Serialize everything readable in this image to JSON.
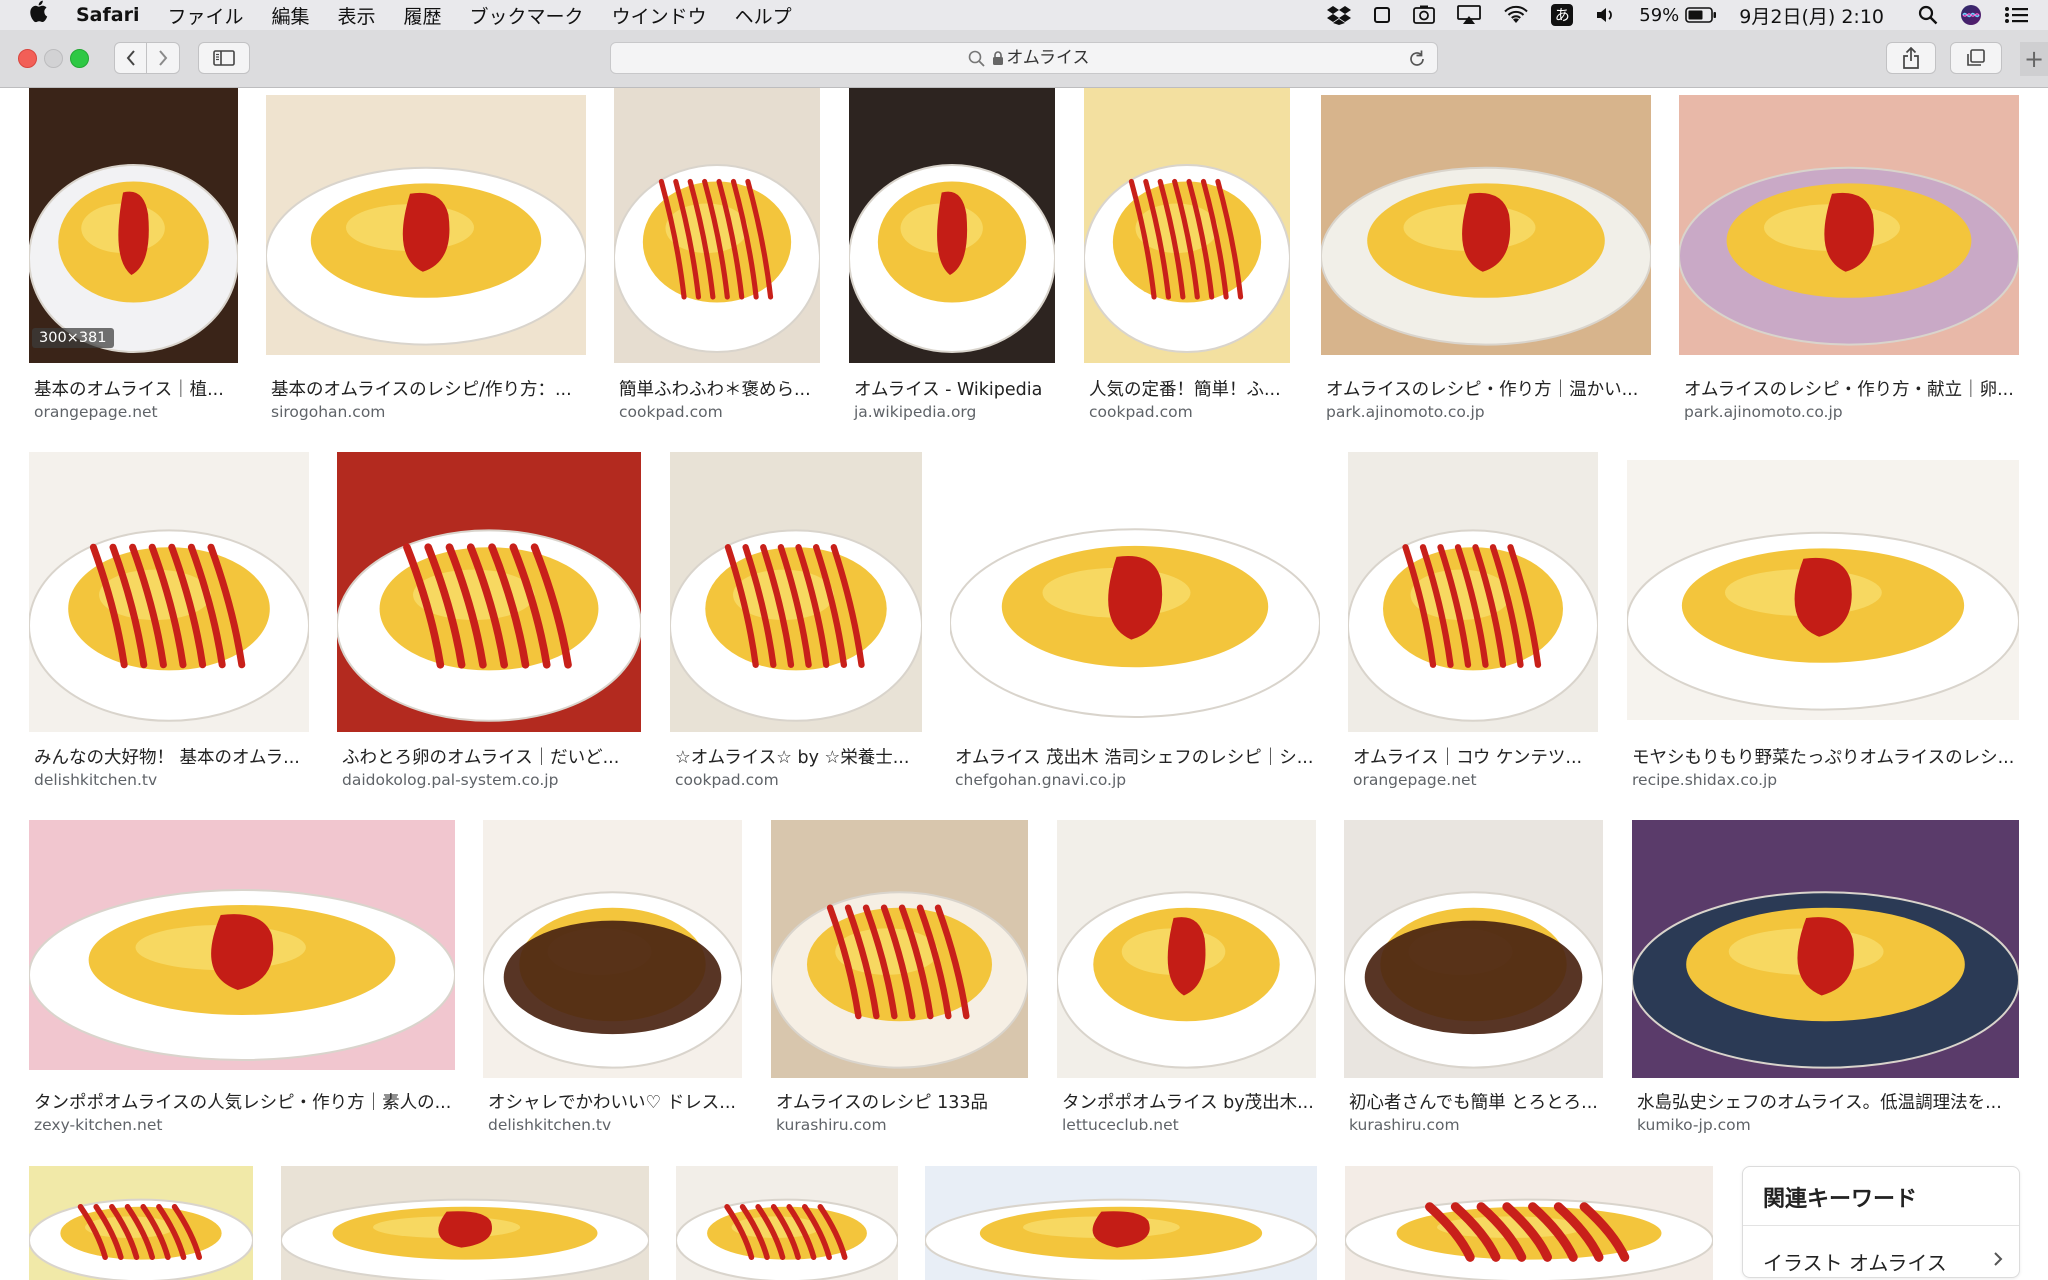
{
  "menubar": {
    "app_name": "Safari",
    "items": [
      "ファイル",
      "編集",
      "表示",
      "履歴",
      "ブックマーク",
      "ウインドウ",
      "ヘルプ"
    ],
    "battery": "59%",
    "clock": "9月2日(月)  2:10",
    "input_method": "あ",
    "status_icons": [
      "dropbox-icon",
      "window-icon",
      "screenshot-icon",
      "airplay-icon",
      "wifi-icon",
      "input-method-icon",
      "volume-icon",
      "battery-icon",
      "spotlight-icon",
      "siri-icon",
      "notification-center-icon"
    ]
  },
  "toolbar": {
    "address": "オムライス",
    "icons": [
      "back-icon",
      "forward-icon",
      "sidebar-icon",
      "search-icon",
      "lock-icon",
      "reload-icon",
      "share-icon",
      "tabs-icon",
      "new-tab-icon"
    ]
  },
  "results": [
    {
      "title": "基本のオムライス｜植...",
      "domain": "orangepage.net",
      "size_badge": "300×381"
    },
    {
      "title": "基本のオムライスのレシピ/作り方：...",
      "domain": "sirogohan.com"
    },
    {
      "title": "簡単ふわふわ＊褒めら...",
      "domain": "cookpad.com"
    },
    {
      "title": "オムライス - Wikipedia",
      "domain": "ja.wikipedia.org"
    },
    {
      "title": "人気の定番！簡単！ふ...",
      "domain": "cookpad.com"
    },
    {
      "title": "オムライスのレシピ・作り方｜温かい...",
      "domain": "park.ajinomoto.co.jp"
    },
    {
      "title": "オムライスのレシピ・作り方・献立｜卵...",
      "domain": "park.ajinomoto.co.jp"
    },
    {
      "title": "みんなの大好物！ 基本のオムラ...",
      "domain": "delishkitchen.tv"
    },
    {
      "title": "ふわとろ卵のオムライス｜だいど...",
      "domain": "daidokolog.pal-system.co.jp"
    },
    {
      "title": "☆オムライス☆ by ☆栄養士...",
      "domain": "cookpad.com"
    },
    {
      "title": "オムライス 茂出木 浩司シェフのレシピ｜シ...",
      "domain": "chefgohan.gnavi.co.jp"
    },
    {
      "title": "オムライス｜コウ ケンテツ...",
      "domain": "orangepage.net"
    },
    {
      "title": "モヤシもりもり野菜たっぷりオムライスのレシ...",
      "domain": "recipe.shidax.co.jp"
    },
    {
      "title": "タンポポオムライスの人気レシピ・作り方｜素人の...",
      "domain": "zexy-kitchen.net"
    },
    {
      "title": "オシャレでかわいい♡ ドレス...",
      "domain": "delishkitchen.tv"
    },
    {
      "title": "オムライスのレシピ 133品",
      "domain": "kurashiru.com"
    },
    {
      "title": "タンポポオムライス by茂出木...",
      "domain": "lettuceclub.net"
    },
    {
      "title": "初心者さんでも簡単 とろとろ...",
      "domain": "kurashiru.com"
    },
    {
      "title": "水島弘史シェフのオムライス。低温調理法を...",
      "domain": "kumiko-jp.com"
    },
    {
      "title": "",
      "domain": ""
    },
    {
      "title": "",
      "domain": ""
    },
    {
      "title": "",
      "domain": ""
    },
    {
      "title": "",
      "domain": ""
    },
    {
      "title": "",
      "domain": ""
    }
  ],
  "related": {
    "heading": "関連キーワード",
    "items": [
      "イラスト オムライス"
    ]
  }
}
